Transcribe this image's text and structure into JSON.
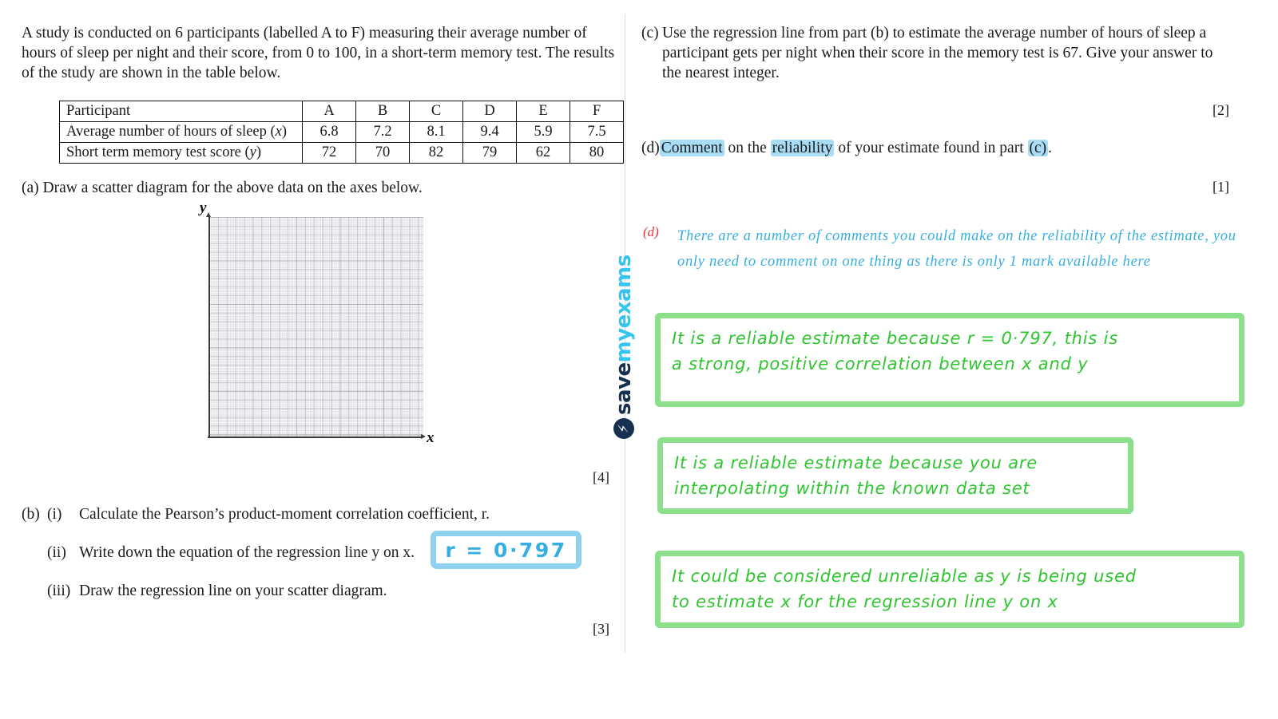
{
  "intro": {
    "paragraph": "A study is conducted on 6 participants (labelled A to F) measuring their average number of hours of sleep per night and their score, from 0 to 100, in a short-term memory test. The results of the study are shown in the table below."
  },
  "table": {
    "row_headers": [
      "Participant",
      "Average number of hours of sleep (x)",
      "Short term memory test score (y)"
    ],
    "participants": [
      "A",
      "B",
      "C",
      "D",
      "E",
      "F"
    ],
    "sleep_hours": [
      "6.8",
      "7.2",
      "8.1",
      "9.4",
      "5.9",
      "7.5"
    ],
    "memory_scores": [
      "72",
      "70",
      "82",
      "79",
      "62",
      "80"
    ],
    "label_sleep_plain": "Average number of hours of sleep (",
    "label_sleep_var": "x",
    "label_score_plain": "Short term memory test score (",
    "label_score_var": "y",
    "paren_close": ")"
  },
  "parts": {
    "a": {
      "label": "(a)",
      "text": "Draw a scatter diagram for the above data on the axes below.",
      "marks": "[4]"
    },
    "b": {
      "label": "(b)",
      "items": [
        {
          "num": "(i)",
          "text": "Calculate the Pearson’s product-moment correlation coefficient, r."
        },
        {
          "num": "(ii)",
          "text": "Write down the equation of the regression line y on x."
        },
        {
          "num": "(iii)",
          "text": "Draw the regression line on your scatter diagram."
        }
      ],
      "marks": "[3]"
    },
    "c": {
      "label": "(c)",
      "text": "Use the regression line from part (b) to estimate the average number of hours of sleep a participant gets per night when their score in the memory test is 67. Give your answer to the nearest integer.",
      "marks": "[2]"
    },
    "d": {
      "label": "(d)",
      "text_before": "",
      "hl_1": "Comment",
      "mid_1": " on the ",
      "hl_2": "reliability",
      "mid_2": " of your estimate found in part ",
      "hl_3": "(c)",
      "text_after": ".",
      "marks": "[1]"
    }
  },
  "graph": {
    "y_axis_label": "y",
    "x_axis_label": "x"
  },
  "answers": {
    "r_value": "r = 0·797",
    "note_d_label": "(d)",
    "note_d_text": "There are a number of comments you could make on the reliability of the estimate, you only need to comment on one thing as there is only 1 mark available here",
    "green_boxes": [
      "It is a reliable  estimate  because  r = 0·797, this is\na strong, positive  correlation  between  x and  y",
      "It is a reliable  estimate  because you are\ninterpolating within  the  known  data set",
      "It could be  considered  unreliable  as  y is being used\nto  estimate  x  for  the  regression line  y on x"
    ]
  },
  "logo": {
    "bolt": "bolt-icon",
    "word_1": "save",
    "word_2": "myexams"
  },
  "colors": {
    "highlight": "#a9dcf5",
    "handwriting_blue": "#35aee2",
    "handwriting_green": "#2ec52e",
    "box_green": "#8ce08c",
    "box_blue": "#8ed2f0",
    "red_label": "#e8343c"
  }
}
